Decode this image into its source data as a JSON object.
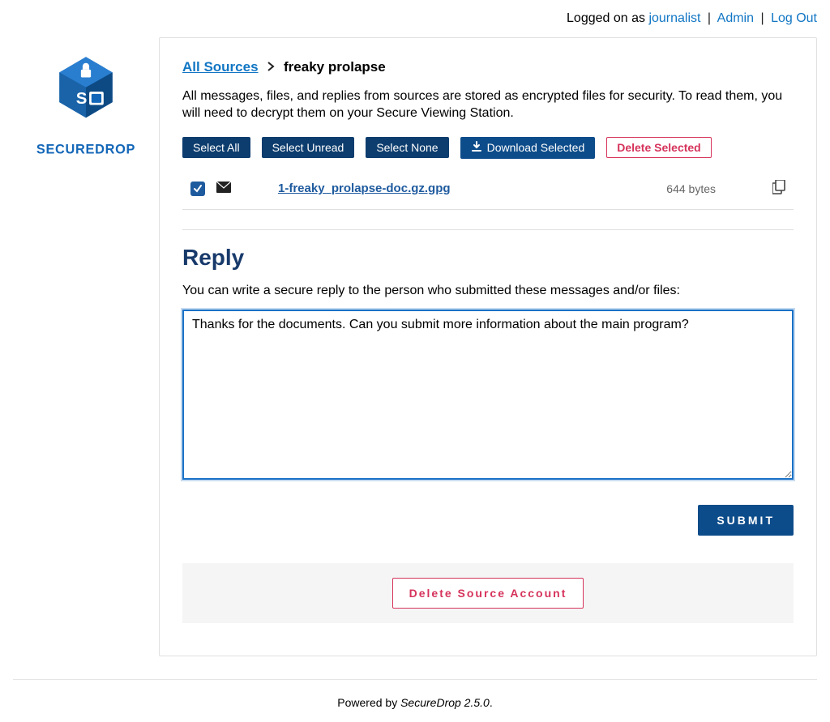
{
  "header": {
    "logged_prefix": "Logged on as ",
    "username": "journalist",
    "admin_link": "Admin",
    "logout_link": "Log Out"
  },
  "breadcrumb": {
    "root": "All Sources",
    "current": "freaky prolapse"
  },
  "intro": "All messages, files, and replies from sources are stored as encrypted files for security. To read them, you will need to decrypt them on your Secure Viewing Station.",
  "toolbar": {
    "select_all": "Select All",
    "select_unread": "Select Unread",
    "select_none": "Select None",
    "download_selected": "Download Selected",
    "delete_selected": "Delete Selected"
  },
  "files": [
    {
      "name": "1-freaky_prolapse-doc.gz.gpg",
      "size": "644 bytes",
      "checked": true
    }
  ],
  "reply": {
    "heading": "Reply",
    "prompt": "You can write a secure reply to the person who submitted these messages and/or files:",
    "value": "Thanks for the documents. Can you submit more information about the main program?",
    "submit_label": "SUBMIT"
  },
  "delete_source_label": "Delete Source Account",
  "footer": {
    "prefix": "Powered by ",
    "product": "SecureDrop 2.5.0",
    "suffix": "."
  }
}
